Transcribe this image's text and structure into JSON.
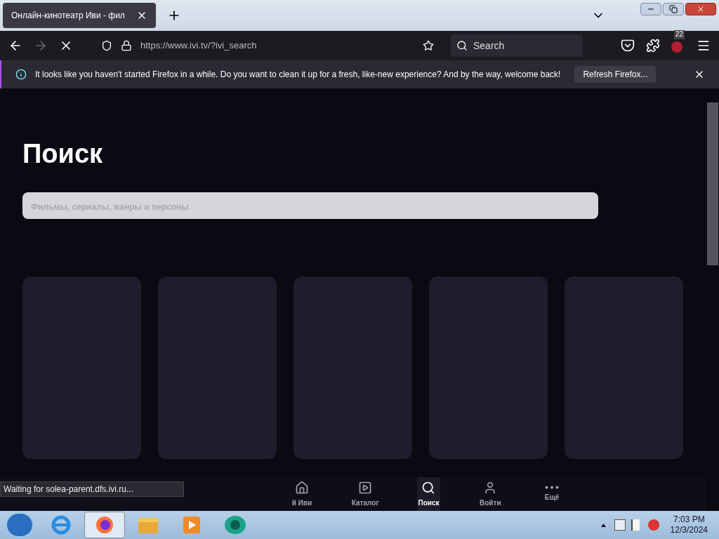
{
  "browser": {
    "tab": {
      "title": "Онлайн-кинотеатр Иви - фил",
      "selected": true
    },
    "url": "https://www.ivi.tv/?ivi_search",
    "search_placeholder": "Search",
    "extensions_badge": "22"
  },
  "notification": {
    "message": "It looks like you haven't started Firefox in a while. Do you want to clean it up for a fresh, like-new experience? And by the way, welcome back!",
    "button": "Refresh Firefox..."
  },
  "page": {
    "title": "Поиск",
    "search": {
      "placeholder": "Фильмы, сериалы, жанры и персоны"
    },
    "cards": [
      {
        "kind": "placeholder"
      },
      {
        "kind": "placeholder"
      },
      {
        "kind": "placeholder"
      },
      {
        "kind": "placeholder"
      },
      {
        "kind": "placeholder"
      }
    ]
  },
  "bottom_nav": [
    {
      "kind": "home",
      "label": "й Иви",
      "selected": false
    },
    {
      "kind": "catalog",
      "label": "Каталог",
      "selected": false
    },
    {
      "kind": "search",
      "label": "Поиск",
      "selected": true
    },
    {
      "kind": "login",
      "label": "Войти",
      "selected": false
    },
    {
      "kind": "more",
      "label": "Ещё",
      "selected": false
    }
  ],
  "status": "Waiting for solea-parent.dfs.ivi.ru...",
  "taskbar": {
    "apps": [
      {
        "kind": "ie",
        "selected": false
      },
      {
        "kind": "firefox",
        "selected": true
      },
      {
        "kind": "explorer",
        "selected": false
      },
      {
        "kind": "media",
        "selected": false
      },
      {
        "kind": "other",
        "selected": false
      }
    ],
    "time": "7:03 PM",
    "date": "12/3/2024"
  }
}
